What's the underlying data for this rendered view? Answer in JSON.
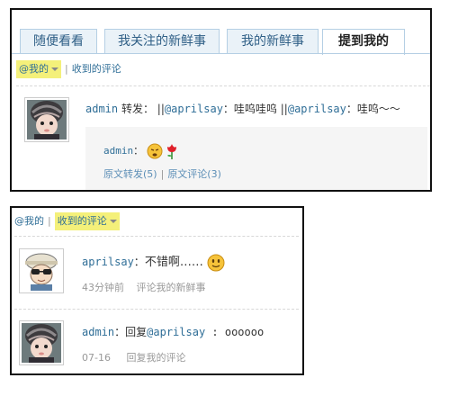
{
  "panel_top": {
    "tabs": [
      {
        "label": "随便看看",
        "active": false
      },
      {
        "label": "我关注的新鲜事",
        "active": false
      },
      {
        "label": "我的新鲜事",
        "active": false
      },
      {
        "label": "提到我的",
        "active": true
      }
    ],
    "filter": {
      "selected": "@我的",
      "sep": "|",
      "other": "收到的评论"
    },
    "feed": {
      "author": "admin",
      "action": "转发：",
      "text_sep1": "||",
      "mention1": "@aprilsay",
      "text1": "：哇呜哇呜",
      "text_sep2": "||",
      "mention2": "@aprilsay",
      "text2": "：哇呜～～",
      "quote": {
        "author": "admin",
        "colon": "：",
        "retweet_link": "原文转发(5)",
        "sep": "|",
        "comment_link": "原文评论(3)"
      }
    }
  },
  "panel_bottom": {
    "filter": {
      "other": "@我的",
      "sep": "|",
      "selected": "收到的评论"
    },
    "comments": [
      {
        "author": "aprilsay",
        "colon": "：",
        "text": "不错啊……",
        "time": "43分钟前",
        "context": "评论我的新鲜事"
      },
      {
        "author": "admin",
        "colon": "：",
        "reply_prefix": "回复",
        "mention": "@aprilsay",
        "text": " : oooooo",
        "time": "07-16",
        "context": "回复我的评论"
      }
    ]
  },
  "colors": {
    "link": "#2f6e97",
    "tab_bg": "#eaf2f8",
    "highlight": "#f4f07a"
  }
}
